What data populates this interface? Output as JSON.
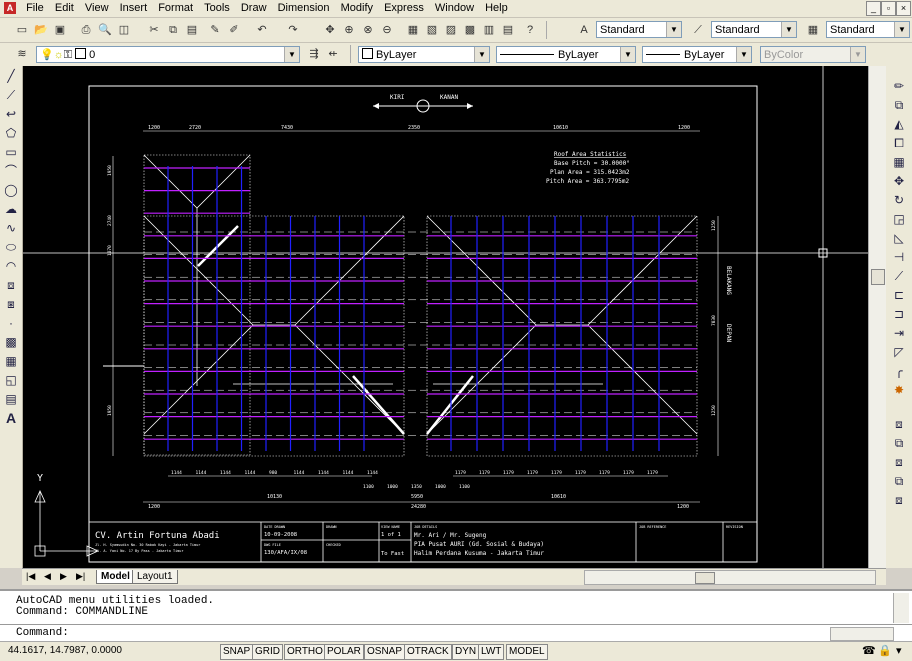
{
  "menu": [
    "File",
    "Edit",
    "View",
    "Insert",
    "Format",
    "Tools",
    "Draw",
    "Dimension",
    "Modify",
    "Express",
    "Window",
    "Help"
  ],
  "styles": {
    "text_style": "Standard",
    "dim_style": "Standard",
    "table_style": "Standard"
  },
  "layers": {
    "current_layer": "0",
    "color": "ByLayer",
    "linetype": "ByLayer",
    "lineweight": "ByLayer",
    "plot_style": "ByColor"
  },
  "drawing": {
    "arrow_left": "KIRI",
    "arrow_right": "KANAN",
    "right_top": "BELAKANG",
    "right_bottom": "DEPAN",
    "stats_title": "Roof Area Statistics",
    "stats_base": "Base Pitch = 30.0000°",
    "stats_plan": "Plan Area = 315.0423m2",
    "stats_pitch": "Pitch Area = 363.7795m2",
    "top_dims": [
      "1200",
      "2720",
      "7430",
      "2350",
      "10610",
      "1200"
    ],
    "bottom_left_dims": [
      "1144",
      "1144",
      "1144",
      "1144",
      "980",
      "1144",
      "1144",
      "1144",
      "1144"
    ],
    "bottom_right_dims": [
      "1179",
      "1179",
      "1179",
      "1179",
      "1179",
      "1179",
      "1179",
      "1179",
      "1179"
    ],
    "mid_dims": [
      "1100",
      "1000",
      "1350",
      "1000",
      "1100"
    ],
    "span_left": "10130",
    "span_mid": "5950",
    "span_right": "10610",
    "total_span": "24280",
    "end_left": "1200",
    "end_right": "1200",
    "right_dims": [
      "1250",
      "7030",
      "1250"
    ],
    "left_dims": [
      "1950",
      "2740",
      "1070",
      "1950"
    ],
    "company": "CV. Artin Fortuna Abadi",
    "address1": "Jl. H. Syamsudin No. 30 Rabak Kayi - Jakarta Timur",
    "address2": "Jl. A. Yani No. 17 By Pass - Jakarta Timur",
    "h_date": "DATE DRAWN",
    "date": "10-09-2008",
    "h_file": "DWG FILE",
    "file": "130/AFA/IX/08",
    "h_drawn": "DRAWN",
    "h_checked": "CHECKED",
    "h_view": "VIEW NAME",
    "view_sheet": "1 of 1",
    "view_name": "To Fast",
    "h_job": "JOB DETAILS",
    "job_client": "Mr. Ari / Mr. Sugeng",
    "job_project": "PIA Pusat AURI (Gd. Sosial & Budaya)",
    "job_address": "Halim Perdana Kusuma - Jakarta Timur",
    "h_ref": "JOB REFERENCE",
    "h_rev": "REVISION",
    "ucs_y": "Y"
  },
  "tabs": [
    "Model",
    "Layout1"
  ],
  "command": {
    "line1": "AutoCAD menu utilities loaded.",
    "line2": "Command: COMMANDLINE",
    "prompt": "Command:"
  },
  "status": {
    "coords": "44.1617, 14.7987, 0.0000",
    "buttons": [
      "SNAP",
      "GRID",
      "ORTHO",
      "POLAR",
      "OSNAP",
      "OTRACK",
      "DYN",
      "LWT",
      "MODEL"
    ]
  }
}
